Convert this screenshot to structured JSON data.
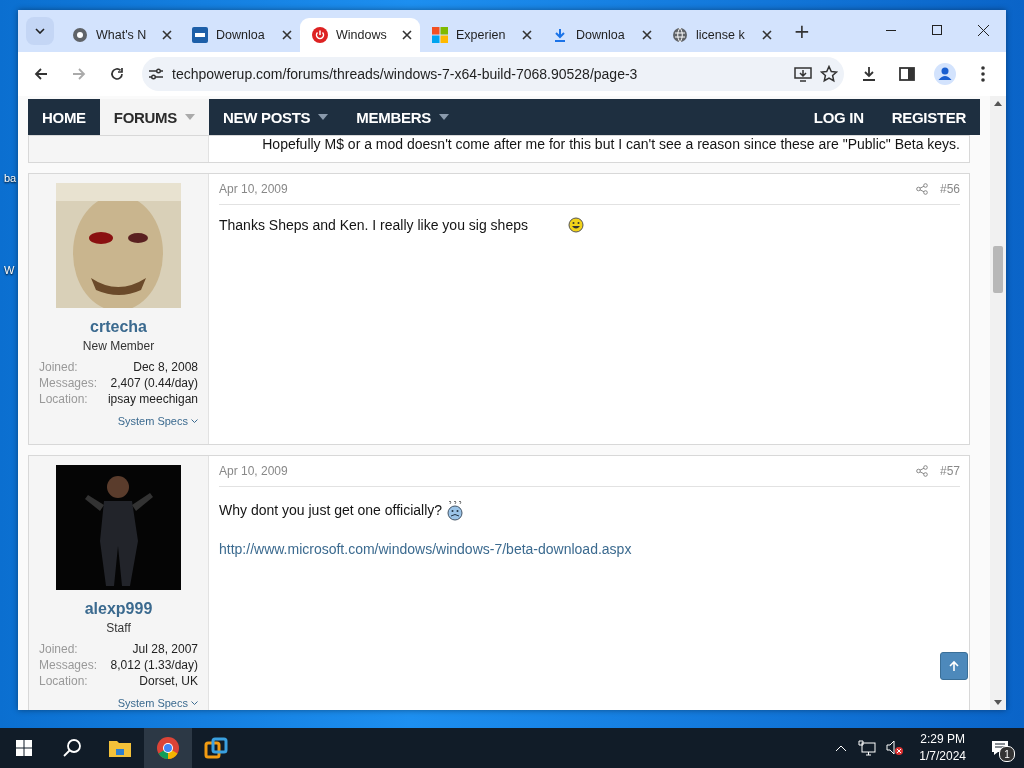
{
  "desktop_labels": [
    "ba",
    "W"
  ],
  "browser": {
    "tabs": [
      {
        "title": "What's N",
        "selected": false
      },
      {
        "title": "Downloa",
        "selected": false
      },
      {
        "title": "Windows",
        "selected": true
      },
      {
        "title": "Experien",
        "selected": false
      },
      {
        "title": "Downloa",
        "selected": false
      },
      {
        "title": "license k",
        "selected": false
      }
    ],
    "new_tab": "+",
    "address": "techpowerup.com/forums/threads/windows-7-x64-build-7068.90528/page-3"
  },
  "nav": {
    "left": [
      {
        "label": "HOME",
        "selected": false,
        "dropdown": false
      },
      {
        "label": "FORUMS",
        "selected": true,
        "dropdown": true
      },
      {
        "label": "NEW POSTS",
        "selected": false,
        "dropdown": true
      },
      {
        "label": "MEMBERS",
        "selected": false,
        "dropdown": true
      }
    ],
    "right": [
      "LOG IN",
      "REGISTER"
    ]
  },
  "previous_post_tail": "Hopefully M$ or a mod doesn't come after me for this but I can't see a reason since these are \"Public\" Beta keys.",
  "posts": [
    {
      "user": {
        "name": "crtecha",
        "title": "New Member",
        "stats": [
          {
            "label": "Joined:",
            "value": "Dec 8, 2008"
          },
          {
            "label": "Messages:",
            "value": "2,407 (0.44/day)"
          },
          {
            "label": "Location:",
            "value": "ipsay meechigan"
          }
        ],
        "specs": "System Specs"
      },
      "date": "Apr 10, 2009",
      "number": "#56",
      "body": [
        {
          "kind": "text",
          "text": "Thanks Sheps and Ken. I really like you sig sheps"
        }
      ]
    },
    {
      "user": {
        "name": "alexp999",
        "title": "Staff",
        "stats": [
          {
            "label": "Joined:",
            "value": "Jul 28, 2007"
          },
          {
            "label": "Messages:",
            "value": "8,012 (1.33/day)"
          },
          {
            "label": "Location:",
            "value": "Dorset, UK"
          }
        ],
        "specs": "System Specs"
      },
      "date": "Apr 10, 2009",
      "number": "#57",
      "body": [
        {
          "kind": "text",
          "text": "Why dont you just get one officially?"
        },
        {
          "kind": "link",
          "text": "http://www.microsoft.com/windows/windows-7/beta-download.aspx"
        }
      ]
    }
  ],
  "taskbar": {
    "time": "2:29 PM",
    "date": "1/7/2024",
    "notifications": "1",
    "volume_muted": true
  }
}
